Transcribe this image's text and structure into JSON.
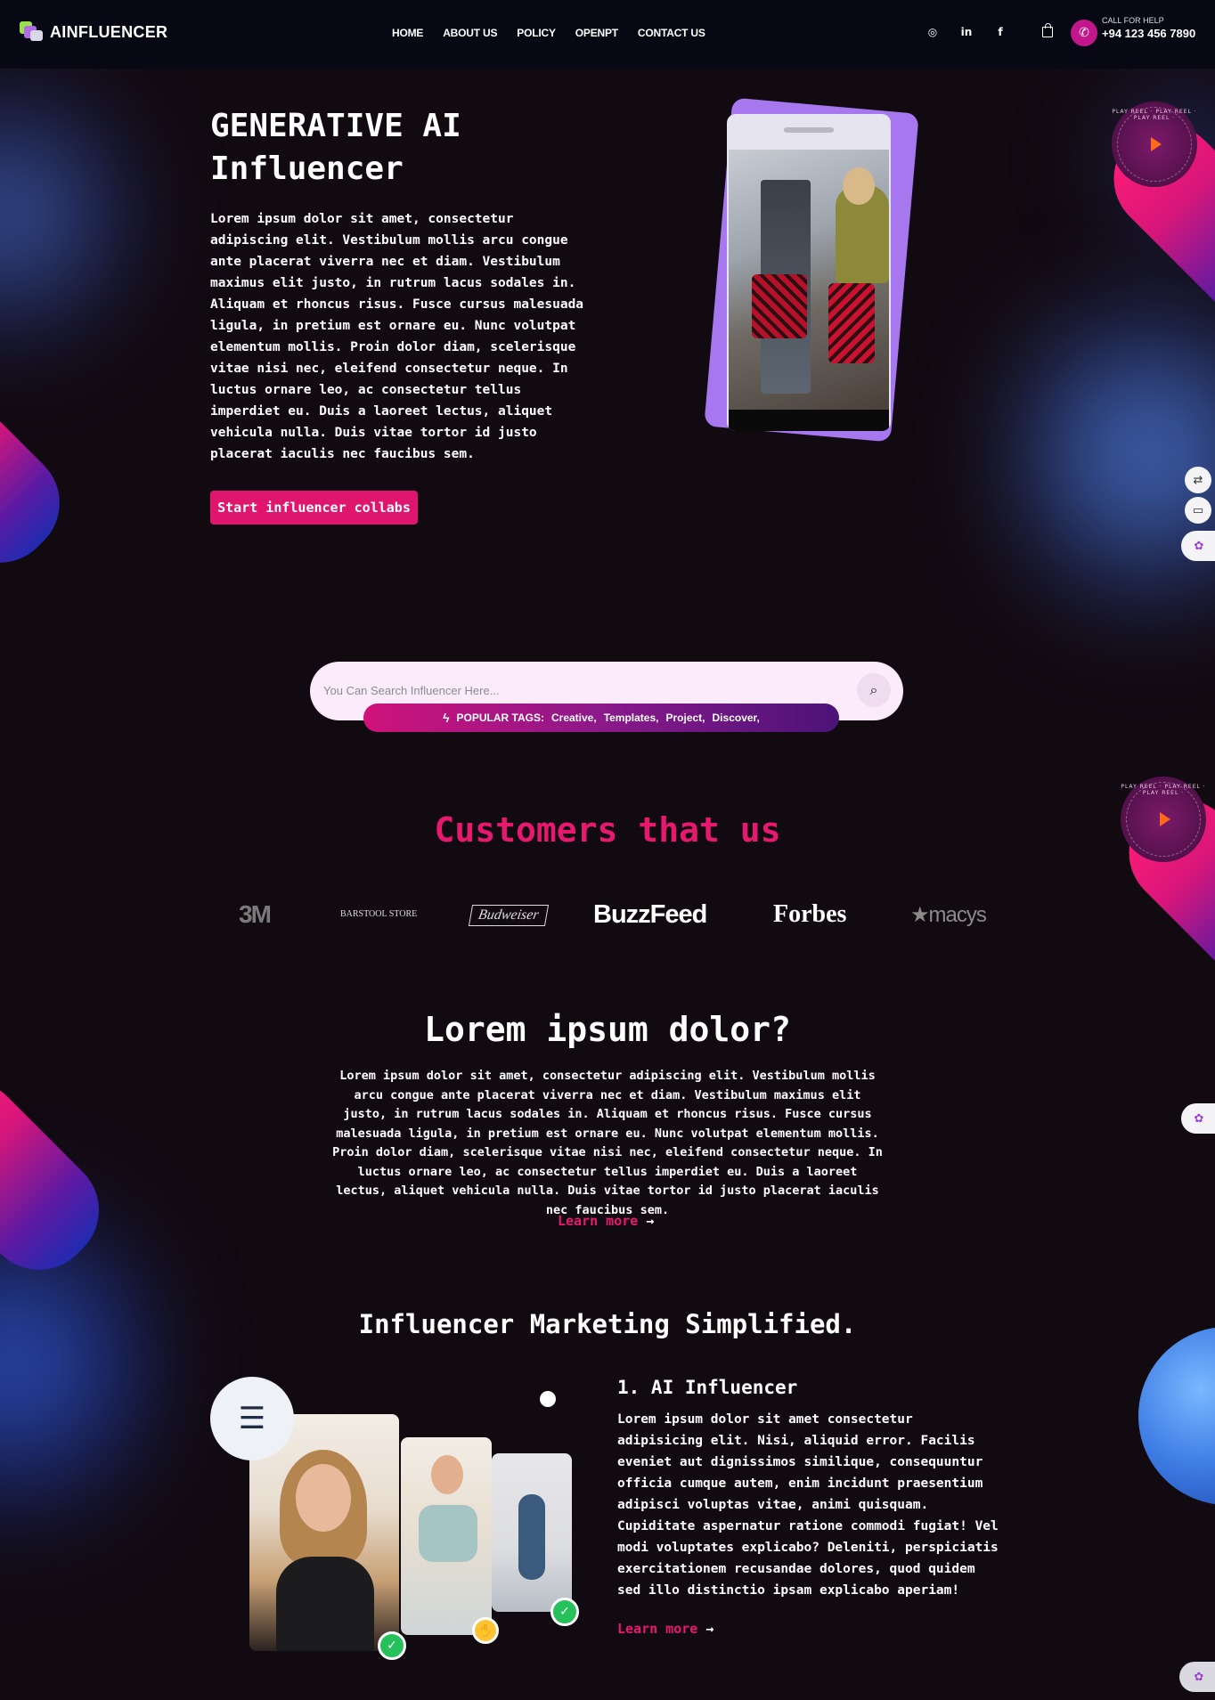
{
  "header": {
    "brand": "AINFLUENCER",
    "nav": [
      "HOME",
      "ABOUT US",
      "POLICY",
      "OPENPT",
      "CONTACT US"
    ],
    "socials": [
      "instagram-icon",
      "linkedin-icon",
      "facebook-icon"
    ],
    "help_label": "CALL FOR HELP",
    "phone": "+94 123 456 7890"
  },
  "hero": {
    "title_line1": "GENERATIVE AI",
    "title_line2": "Influencer",
    "text": "Lorem ipsum dolor sit amet, consectetur adipiscing elit. Vestibulum mollis arcu congue ante placerat viverra nec et diam. Vestibulum maximus elit justo, in rutrum lacus sodales in. Aliquam et rhoncus risus. Fusce cursus malesuada ligula, in pretium est ornare eu. Nunc volutpat elementum mollis. Proin dolor diam, scelerisque vitae nisi nec, eleifend consectetur neque. In luctus ornare leo, ac consectetur tellus imperdiet eu. Duis a laoreet lectus, aliquet vehicula nulla. Duis vitae tortor id justo placerat iaculis nec faucibus sem.",
    "cta": "Start influencer collabs"
  },
  "reel": {
    "label": "PLAY REEL · PLAY REEL · PLAY REEL ·"
  },
  "search": {
    "placeholder": "You Can Search Influencer Here...",
    "tags_label": "POPULAR TAGS:",
    "tags": [
      "Creative,",
      "Templates,",
      "Project,",
      "Discover,"
    ]
  },
  "customers": {
    "title": "Customers that us",
    "brands": [
      "3M",
      "BARSTOOL STORE",
      "Budweiser",
      "BuzzFeed",
      "Forbes",
      "★macys"
    ]
  },
  "lorem": {
    "title": "Lorem ipsum dolor?",
    "text": "Lorem ipsum dolor sit amet, consectetur adipiscing elit. Vestibulum mollis arcu congue ante placerat viverra nec et diam. Vestibulum maximus elit justo, in rutrum lacus sodales in. Aliquam et rhoncus risus. Fusce cursus malesuada ligula, in pretium est ornare eu. Nunc volutpat elementum mollis. Proin dolor diam, scelerisque vitae nisi nec, eleifend consectetur neque. In luctus ornare leo, ac consectetur tellus imperdiet eu. Duis a laoreet lectus, aliquet vehicula nulla. Duis vitae tortor id justo placerat iaculis nec faucibus sem.",
    "learn_more": "Learn more"
  },
  "marketing": {
    "title": "Influencer Marketing Simplified.",
    "item_title": "1. AI Influencer",
    "item_text": "Lorem ipsum dolor sit amet consectetur adipisicing elit. Nisi, aliquid error. Facilis eveniet aut dignissimos similique, consequuntur officia cumque autem, enim incidunt praesentium adipisci voluptas vitae, animi quisquam. Cupiditate aspernatur ratione commodi fugiat! Vel modi voluptates explicabo? Deleniti, perspiciatis exercitationem recusandae dolores, quod quidem sed illo distinctio ipsam explicabo aperiam!",
    "learn_more": "Learn more"
  },
  "colors": {
    "accent": "#e0156e",
    "background": "#120a11",
    "header": "#070813",
    "purple": "#a777f0"
  }
}
